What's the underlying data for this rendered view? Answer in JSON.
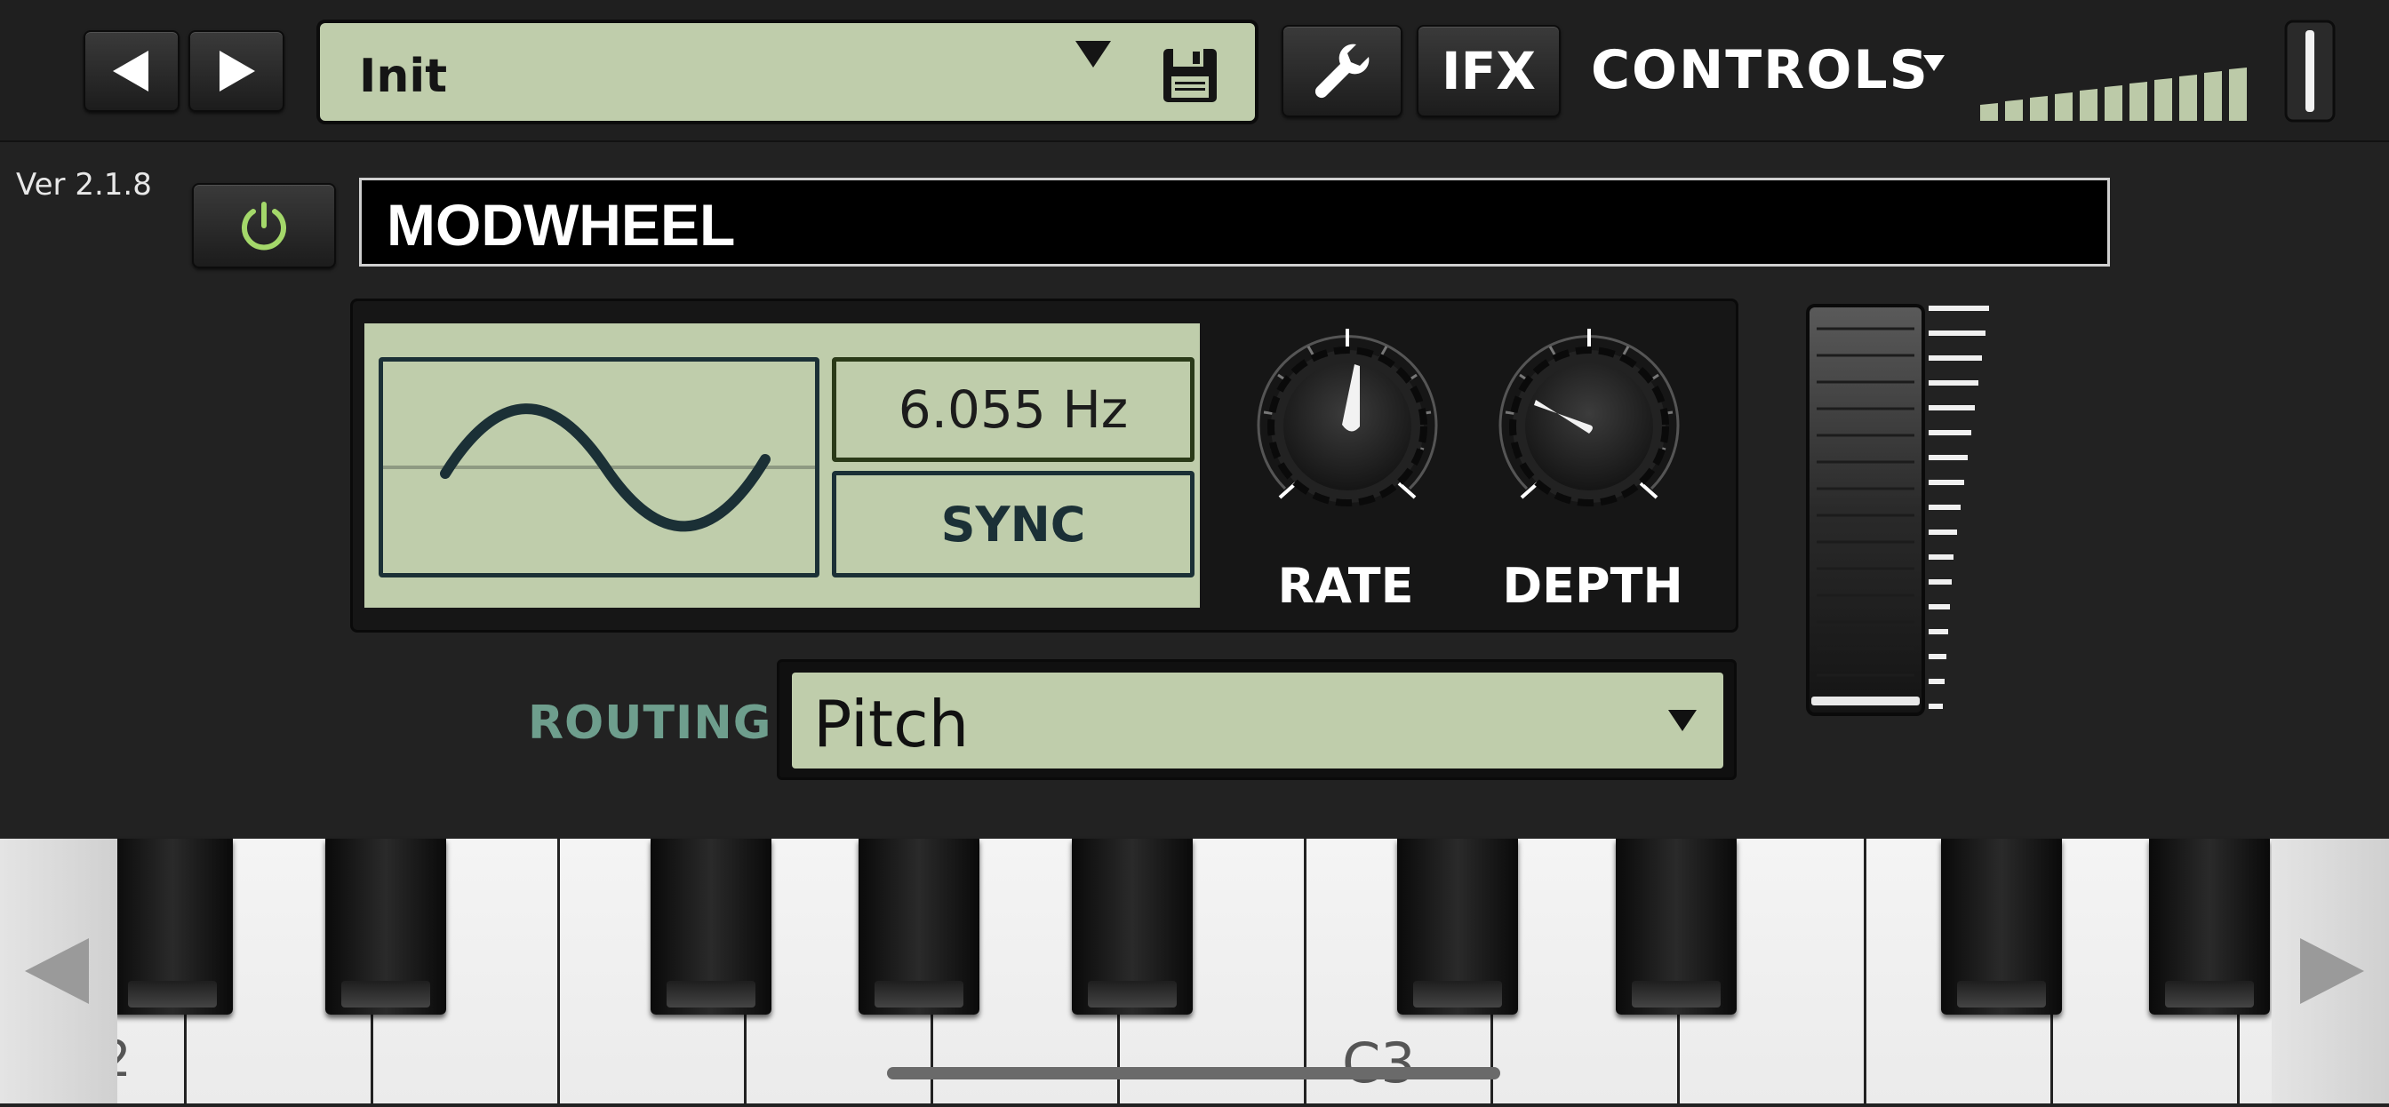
{
  "toolbar": {
    "prev_icon": "prev-arrow-icon",
    "next_icon": "next-arrow-icon",
    "preset_name": "Init",
    "save_icon": "floppy-disk-icon",
    "settings_icon": "wrench-icon",
    "ifx_label": "IFX",
    "controls_label": "CONTROLS",
    "volume_level": 0.92
  },
  "version": "Ver 2.1.8",
  "panel": {
    "title": "MODWHEEL",
    "power_icon": "power-icon",
    "lfo": {
      "waveform": "sine",
      "frequency": "6.055 Hz",
      "sync_label": "SYNC"
    },
    "knobs": {
      "rate_label": "RATE",
      "depth_label": "DEPTH"
    },
    "routing": {
      "label": "ROUTING",
      "value": "Pitch"
    },
    "modwheel_level": 0.0
  },
  "keyboard": {
    "note_label": "C3",
    "partial_label_left": "2",
    "scroll_left_icon": "left-triangle-icon",
    "scroll_right_icon": "right-triangle-icon"
  },
  "colors": {
    "lcd": "#bfcdab",
    "routing_label": "#6e9e8d",
    "power_green": "#a4d86a"
  }
}
